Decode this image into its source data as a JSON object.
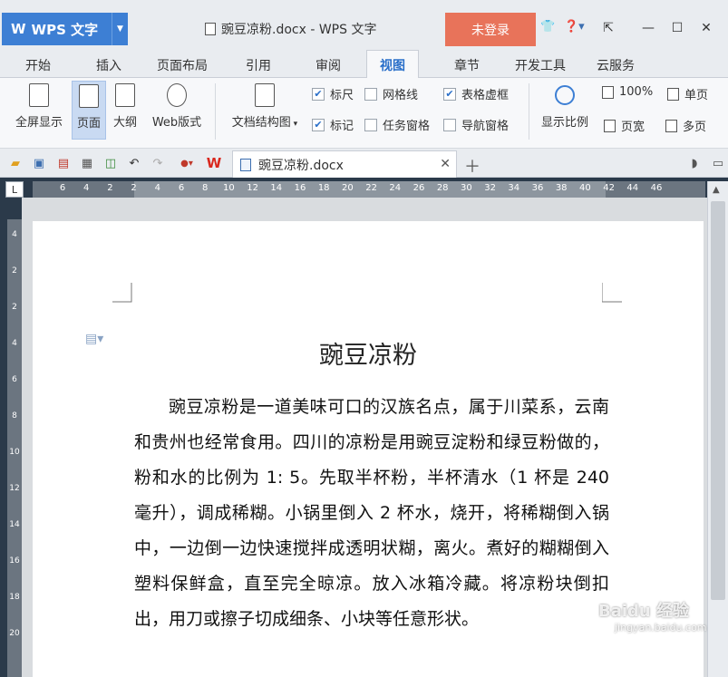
{
  "titlebar": {
    "app_logo": "W",
    "app_name": "WPS 文字",
    "doc_title": "豌豆凉粉.docx - WPS 文字",
    "login_label": "未登录"
  },
  "tabs": [
    {
      "label": "开始"
    },
    {
      "label": "插入"
    },
    {
      "label": "页面布局"
    },
    {
      "label": "引用"
    },
    {
      "label": "审阅"
    },
    {
      "label": "视图"
    },
    {
      "label": "章节"
    },
    {
      "label": "开发工具"
    },
    {
      "label": "云服务"
    }
  ],
  "ribbon": {
    "fullscreen": "全屏显示",
    "page": "页面",
    "outline": "大纲",
    "web": "Web版式",
    "doc_structure": "文档结构图",
    "ruler": "标尺",
    "gridlines": "网格线",
    "table_gridlines": "表格虚框",
    "marks": "标记",
    "task_pane": "任务窗格",
    "nav_pane": "导航窗格",
    "zoom": "显示比例",
    "zoom_100": "100%",
    "page_width": "页宽",
    "single_page": "单页",
    "multi_page": "多页",
    "checks": {
      "ruler": true,
      "gridlines": false,
      "table_gridlines": true,
      "marks": true,
      "task_pane": false,
      "nav_pane": false
    }
  },
  "doc_tab": {
    "label": "豌豆凉粉.docx"
  },
  "ruler": {
    "corner": "L",
    "h_ticks": [
      "6",
      "4",
      "2",
      "2",
      "4",
      "6",
      "8",
      "10",
      "12",
      "14",
      "16",
      "18",
      "20",
      "22",
      "24",
      "26",
      "28",
      "30",
      "32",
      "34",
      "36",
      "38",
      "40",
      "42",
      "44",
      "46"
    ],
    "v_ticks": [
      "4",
      "2",
      "2",
      "4",
      "6",
      "8",
      "10",
      "12",
      "14",
      "16",
      "18",
      "20"
    ]
  },
  "document": {
    "title": "豌豆凉粉",
    "paragraph": "豌豆凉粉是一道美味可口的汉族名点，属于川菜系，云南和贵州也经常食用。四川的凉粉是用豌豆淀粉和绿豆粉做的，粉和水的比例为 1: 5。先取半杯粉，半杯清水（1 杯是 240 毫升），调成稀糊。小锅里倒入 2 杯水，烧开，将稀糊倒入锅中，一边倒一边快速搅拌成透明状糊，离火。煮好的糊糊倒入塑料保鲜盒，直至完全晾凉。放入冰箱冷藏。将凉粉块倒扣出，用刀或擦子切成细条、小块等任意形状。"
  },
  "watermark": {
    "text": "Baidu 经验",
    "sub": "jingyan.baidu.com"
  },
  "colors": {
    "accent": "#2a6fc9",
    "app_button": "#3d7fd4",
    "login_button": "#e8735a"
  }
}
